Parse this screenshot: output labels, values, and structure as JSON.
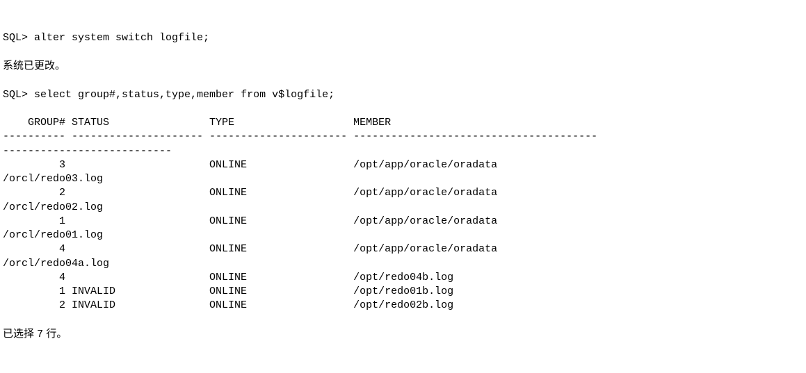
{
  "line1_prompt": "SQL> ",
  "line1_cmd": "alter system switch logfile;",
  "line2_blank": "",
  "line3_msg": "系统已更改。",
  "line4_blank": "",
  "line5_prompt": "SQL> ",
  "line5_cmd": "select group#,status,type,member from v$logfile;",
  "line6_blank": "",
  "header": "    GROUP# STATUS                TYPE                   MEMBER",
  "sep1": "---------- --------------------- ---------------------- ---------------------------------------",
  "sep2": "---------------------------",
  "r1a": "         3                       ONLINE                 /opt/app/oracle/oradata",
  "r1b": "/orcl/redo03.log",
  "r2a": "         2                       ONLINE                 /opt/app/oracle/oradata",
  "r2b": "/orcl/redo02.log",
  "r3a": "         1                       ONLINE                 /opt/app/oracle/oradata",
  "r3b": "/orcl/redo01.log",
  "r4a": "         4                       ONLINE                 /opt/app/oracle/oradata",
  "r4b": "/orcl/redo04a.log",
  "r5": "         4                       ONLINE                 /opt/redo04b.log",
  "r6": "         1 INVALID               ONLINE                 /opt/redo01b.log",
  "r7": "         2 INVALID               ONLINE                 /opt/redo02b.log",
  "line_end_blank": "",
  "footer_prefix": "已选择 ",
  "footer_count": "7",
  "footer_suffix": " 行。"
}
